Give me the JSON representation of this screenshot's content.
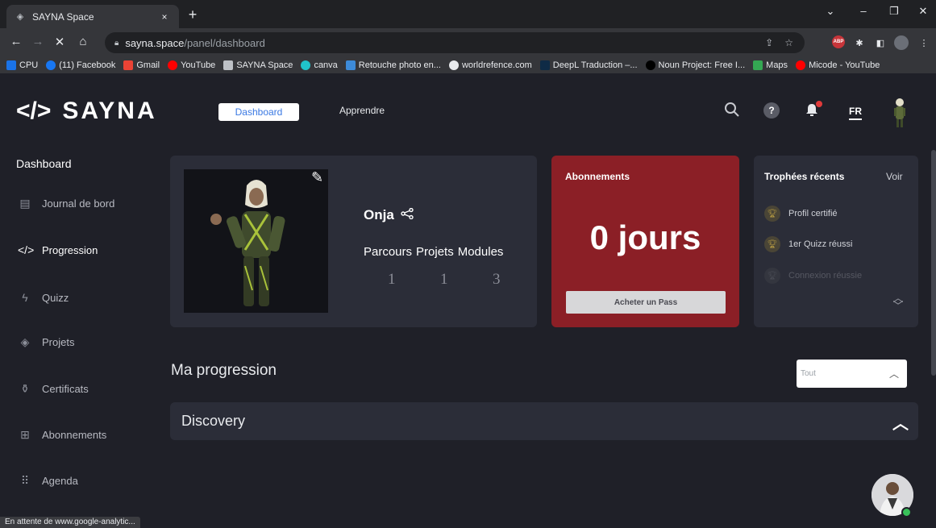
{
  "browser": {
    "tab_title": "SAYNA Space",
    "tab_close": "×",
    "new_tab": "+",
    "url_host": "sayna.space",
    "url_path": "/panel/dashboard",
    "window_controls": [
      "⌄",
      "–",
      "❐",
      "✕"
    ],
    "bookmarks": [
      {
        "label": "CPU",
        "color": "#1a73e8"
      },
      {
        "label": "(11) Facebook",
        "color": "#1877f2"
      },
      {
        "label": "Gmail",
        "color": "#ea4335"
      },
      {
        "label": "YouTube",
        "color": "#ff0000"
      },
      {
        "label": "SAYNA Space",
        "color": "#bdc1c6"
      },
      {
        "label": "canva",
        "color": "#20c4cb"
      },
      {
        "label": "Retouche photo en...",
        "color": "#3d8bd9"
      },
      {
        "label": "worldrefence.com",
        "color": "#e8eaed"
      },
      {
        "label": "DeepL Traduction –...",
        "color": "#0f2b46"
      },
      {
        "label": "Noun Project: Free I...",
        "color": "#000000"
      },
      {
        "label": "Maps",
        "color": "#34a853"
      },
      {
        "label": "Micode - YouTube",
        "color": "#ff0000"
      }
    ],
    "status_text": "En attente de www.google-analytic..."
  },
  "header": {
    "brand": "SAYNA",
    "nav_dashboard": "Dashboard",
    "nav_apprendre": "Apprendre",
    "help": "?",
    "lang": "FR"
  },
  "sidebar": {
    "title": "Dashboard",
    "items": [
      {
        "label": "Journal de bord",
        "icon": "book-icon"
      },
      {
        "label": "Progression",
        "icon": "sayna-logo-icon"
      },
      {
        "label": "Quizz",
        "icon": "lightning-icon"
      },
      {
        "label": "Projets",
        "icon": "target-icon"
      },
      {
        "label": "Certificats",
        "icon": "medal-icon"
      },
      {
        "label": "Abonnements",
        "icon": "gift-icon"
      },
      {
        "label": "Agenda",
        "icon": "grid-dots-icon"
      }
    ]
  },
  "profile": {
    "name": "Onja",
    "stat_labels": [
      "Parcours",
      "Projets",
      "Modules"
    ],
    "stat_values": [
      "1",
      "1",
      "3"
    ]
  },
  "subscription": {
    "title": "Abonnements",
    "days": "0 jours",
    "buy_label": "Acheter un Pass",
    "color": "#8b1f26"
  },
  "trophies": {
    "title": "Trophées récents",
    "see_all": "Voir",
    "items": [
      {
        "label": "Profil certifié",
        "unlocked": true
      },
      {
        "label": "1er Quizz réussi",
        "unlocked": true
      },
      {
        "label": "Connexion réussie",
        "unlocked": false
      }
    ]
  },
  "progression": {
    "title": "Ma progression",
    "filter_value": "Tout",
    "sections": [
      {
        "title": "Discovery"
      }
    ]
  }
}
